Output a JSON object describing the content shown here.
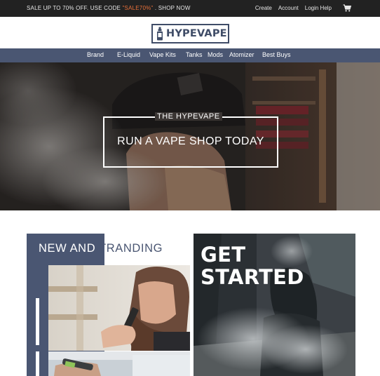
{
  "promo": {
    "prefix": "SALE UP TO 70% OFF. USE CODE ",
    "code": "\"SALE70%\"",
    "suffix": " . SHOP NOW"
  },
  "account_links": [
    "Create",
    "Account",
    "Login Help"
  ],
  "cart_icon": "cart-icon",
  "logo": {
    "text": "HYPEVAPE",
    "icon": "vape-bottle-icon"
  },
  "nav": [
    "Brand",
    "E-Liquid",
    "Vape Kits",
    "Tanks",
    "Mods",
    "Atomizer",
    "Best Buys"
  ],
  "hero": {
    "label": "THE HYPEVAPE",
    "title": "RUN A VAPE SHOP TODAY"
  },
  "trending": {
    "title_part1": "NEW AND ",
    "title_part2": "TRANDING"
  },
  "get_started": {
    "line1": "GET",
    "line2": "STARTED"
  },
  "colors": {
    "topbar": "#222222",
    "brand_navy": "#4a5672",
    "logo_navy": "#3f4c67",
    "promo_code": "#e8703a"
  }
}
